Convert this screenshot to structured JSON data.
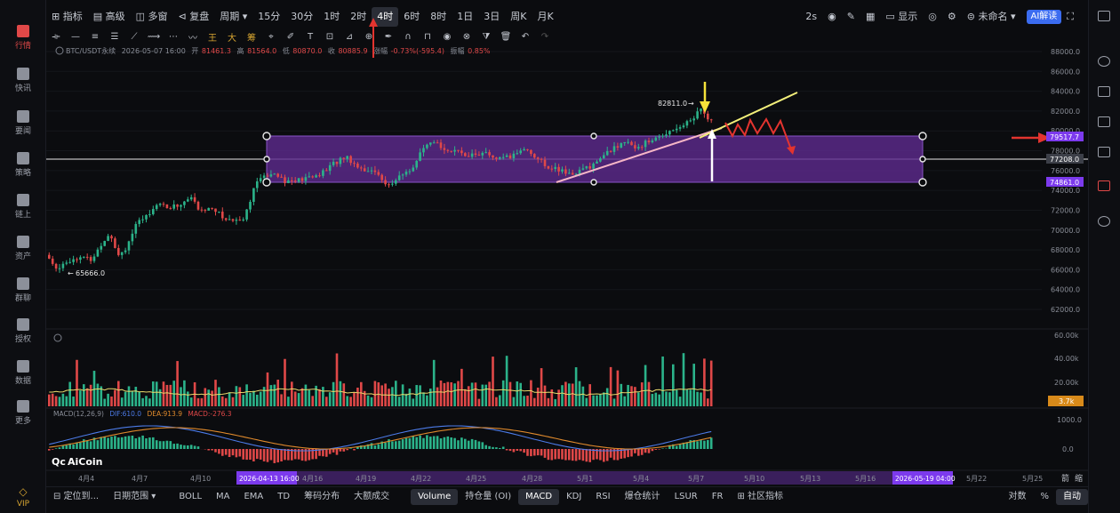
{
  "sidebar": {
    "items": [
      {
        "label": "行情",
        "icon": "bar-chart-icon",
        "active": true
      },
      {
        "label": "快讯",
        "icon": "news-icon"
      },
      {
        "label": "要闻",
        "icon": "document-icon"
      },
      {
        "label": "策略",
        "icon": "robot-icon"
      },
      {
        "label": "链上",
        "icon": "chain-icon"
      },
      {
        "label": "资产",
        "icon": "wallet-icon"
      },
      {
        "label": "群聊",
        "icon": "chat-icon"
      },
      {
        "label": "授权",
        "icon": "key-icon"
      },
      {
        "label": "数据",
        "icon": "data-icon"
      },
      {
        "label": "更多",
        "icon": "grid-icon"
      }
    ],
    "vip": "VIP"
  },
  "toolbar": {
    "indicator": "指标",
    "advanced": "高级",
    "multi_window": "多窗",
    "replay": "复盘",
    "period": "周期",
    "intervals": [
      "15分",
      "30分",
      "1时",
      "2时",
      "4时",
      "6时",
      "8时",
      "1日",
      "3日",
      "周K",
      "月K"
    ],
    "selected_interval": "4时",
    "refresh": "2s",
    "display": "显示",
    "unnamed": "未命名",
    "ai_badge": "AI解读"
  },
  "chart_info": {
    "symbol": "BTC/USDT永续",
    "time": "2026-05-07 16:00",
    "open_label": "开",
    "open": "81461.3",
    "high_label": "高",
    "high": "81564.0",
    "low_label": "低",
    "low": "80870.0",
    "close_label": "收",
    "close": "80885.9",
    "change_label": "涨幅",
    "change": "-0.73%(-595.4)",
    "amp_label": "振幅",
    "amp": "0.85%"
  },
  "price_axis": [
    "88000.0",
    "86000.0",
    "84000.0",
    "82000.0",
    "80000.0",
    "78000.0",
    "76000.0",
    "74000.0",
    "72000.0",
    "70000.0",
    "68000.0",
    "66000.0",
    "64000.0",
    "62000.0"
  ],
  "price_tags": {
    "upper": "79517.7",
    "mid": "77208.0",
    "lower": "74861.0"
  },
  "annotations": {
    "high_mark": "82811.0",
    "low_mark": "65666.0"
  },
  "volume_axis": [
    "60.00k",
    "40.00k",
    "20.00k"
  ],
  "volume_tag": "3.7k",
  "macd": {
    "label": "MACD(12,26,9)",
    "dif": "DIF:610.0",
    "dea": "DEA:913.9",
    "macd": "MACD:-276.3",
    "axis": [
      "1000.0",
      "0.0"
    ]
  },
  "watermark": "AiCoin",
  "time_axis": [
    "4月4",
    "4月7",
    "4月10",
    "4月16",
    "4月19",
    "4月22",
    "4月25",
    "4月28",
    "5月1",
    "5月4",
    "5月7",
    "5月10",
    "5月13",
    "5月16",
    "5月22",
    "5月25"
  ],
  "time_tags": {
    "cursor_left": "2026-04-13 16:00",
    "cursor_right": "2026-05-19 04:00"
  },
  "scale_buttons": {
    "compress": "箭",
    "expand": "缩"
  },
  "bottombar": {
    "locate": "定位到...",
    "date_range": "日期范围",
    "indicators": [
      "BOLL",
      "MA",
      "EMA",
      "TD",
      "筹码分布",
      "大额成交"
    ],
    "panels": [
      "Volume",
      "持仓量 (OI)",
      "MACD",
      "KDJ",
      "RSI",
      "爆仓统计",
      "LSUR",
      "FR"
    ],
    "community": "社区指标",
    "log": "对数",
    "percent": "%",
    "auto": "自动"
  },
  "colors": {
    "up": "#2bb38a",
    "down": "#e04848",
    "box": "#5b2a8c",
    "trendline_yellow": "#f3ef7a",
    "trendline_pink": "#f6b6c6",
    "arrow_red": "#e3342f",
    "arrow_yellow": "#f5e23a",
    "tag_purple": "#7c3aed",
    "tag_orange": "#d88a1a"
  }
}
